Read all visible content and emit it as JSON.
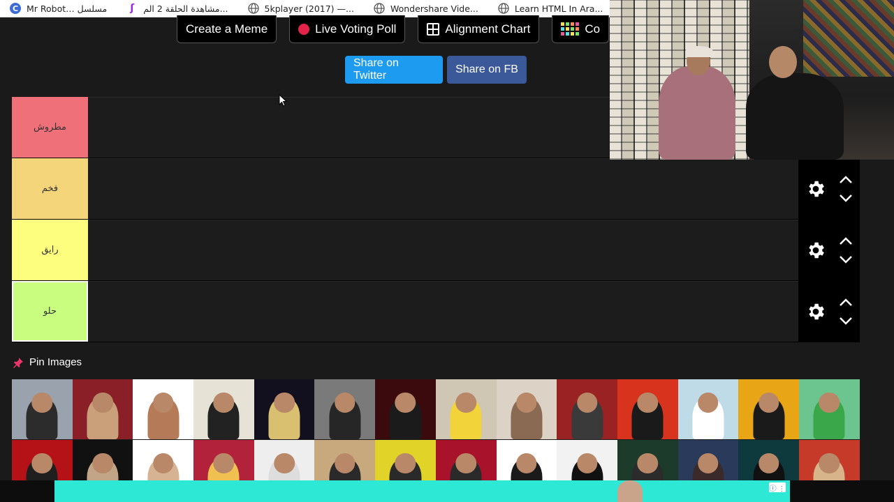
{
  "bookmarks": [
    {
      "icon": "c-logo-icon",
      "label": "Mr Robot… مسلسل"
    },
    {
      "icon": "s-logo-icon",
      "label": "مشاهدة الحلقة 2 الم..."
    },
    {
      "icon": "globe-icon",
      "label": "5kplayer (2017) —..."
    },
    {
      "icon": "globe-icon",
      "label": "Wondershare Vide..."
    },
    {
      "icon": "globe-icon",
      "label": "Learn HTML In Ara..."
    }
  ],
  "actions": {
    "create_meme": "Create a Meme",
    "live_voting_poll": "Live Voting Poll",
    "alignment_chart": "Alignment Chart",
    "color_grid_partial": "Co"
  },
  "share": {
    "twitter": "Share on Twitter",
    "fb": "Share on FB"
  },
  "tiers": [
    {
      "label": "مطروش",
      "color": "#f0707a"
    },
    {
      "label": "فخم",
      "color": "#f5d57a"
    },
    {
      "label": "رايق",
      "color": "#fdfd7e"
    },
    {
      "label": "حلو",
      "color": "#c8fd7f"
    }
  ],
  "pin_images": {
    "title": "Pin Images",
    "thumb_colors": [
      [
        "#9aa3ad",
        "#2c2c2c"
      ],
      [
        "#8a1f28",
        "#caa07a"
      ],
      [
        "#ffffff",
        "#b57a58"
      ],
      [
        "#e7e2d6",
        "#222222"
      ],
      [
        "#120f1e",
        "#d8c070"
      ],
      [
        "#7a7a7a",
        "#262626"
      ],
      [
        "#3a0a0c",
        "#1b1b1b"
      ],
      [
        "#cfc6b4",
        "#f2d43a"
      ],
      [
        "#dcd2c6",
        "#8a6a52"
      ],
      [
        "#9a2222",
        "#3a3a3a"
      ],
      [
        "#d8331c",
        "#1a1a1a"
      ],
      [
        "#bfdbe8",
        "#ffffff"
      ],
      [
        "#e8a516",
        "#1a1a1a"
      ],
      [
        "#6cc48e",
        "#3aa84a"
      ],
      [
        "#b51218",
        "#1f1f1f"
      ],
      [
        "#111111",
        "#c2a486"
      ],
      [
        "#ffffff",
        "#d6b392"
      ],
      [
        "#b3223b",
        "#f0c050"
      ],
      [
        "#eeeeee",
        "#dddddd"
      ],
      [
        "#c8a97e",
        "#2a2a2a"
      ],
      [
        "#e2d328",
        "#2a2a2a"
      ],
      [
        "#a8122a",
        "#2a2a2a"
      ],
      [
        "#ffffff",
        "#1a1a1a"
      ],
      [
        "#f2f2f2",
        "#111111"
      ],
      [
        "#1d3b2a",
        "#2b2b2b"
      ],
      [
        "#2a3a5a",
        "#3a2a2a"
      ],
      [
        "#0e3a3e",
        "#111111"
      ],
      [
        "#c63a2a",
        "#d8b48a"
      ]
    ]
  },
  "ad": {
    "info": "ⓘ ⋮"
  }
}
